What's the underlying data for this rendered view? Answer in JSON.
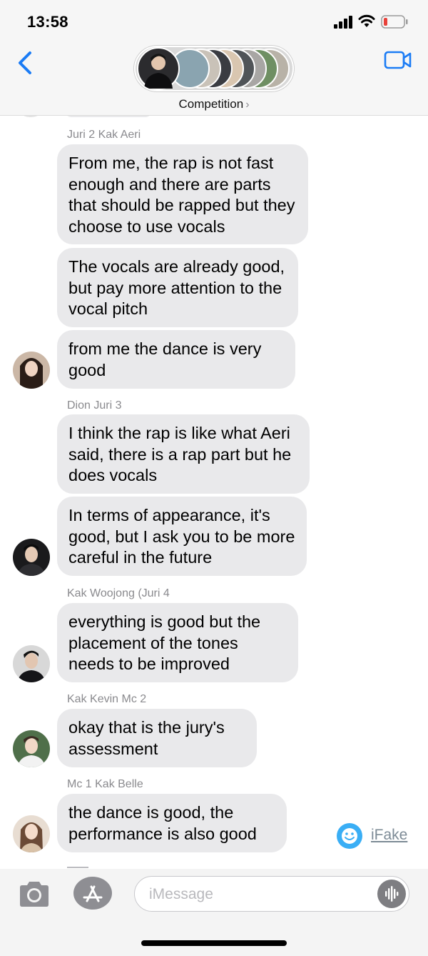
{
  "status": {
    "time": "13:58"
  },
  "header": {
    "group_name": "Competition",
    "chevron": "›"
  },
  "messages": [
    {
      "sender": "Juri 2 Kak Aeri",
      "bubbles": [
        "From me, the rap is not fast enough and there are parts that should be rapped but they choose to use vocals",
        "The vocals are already good, but pay more attention to the vocal pitch",
        "from me the dance is very good"
      ]
    },
    {
      "sender": "Dion Juri 3",
      "bubbles": [
        "I think the rap is like what Aeri said, there is a rap part but he does vocals",
        "In terms of appearance, it's good, but I ask you to be more careful in the future"
      ]
    },
    {
      "sender": "Kak Woojong (Juri 4",
      "bubbles": [
        "everything is good but the placement of the tones needs to be improved"
      ]
    },
    {
      "sender": "Kak Kevin Mc 2",
      "bubbles": [
        "okay that is the jury's assessment"
      ]
    },
    {
      "sender": "Mc 1 Kak Belle",
      "bubbles": [
        "the dance is good, the performance is also good"
      ]
    }
  ],
  "watermark": {
    "label": "iFake"
  },
  "composer": {
    "placeholder": "iMessage"
  },
  "colors": {
    "accent": "#1b7cf5",
    "bubble": "#e9e9eb",
    "sender_text": "#8a8a8e"
  },
  "icons": [
    "back-chevron-icon",
    "video-camera-icon",
    "camera-icon",
    "app-store-icon",
    "audio-wave-icon",
    "signal-icon",
    "wifi-icon",
    "battery-icon"
  ]
}
